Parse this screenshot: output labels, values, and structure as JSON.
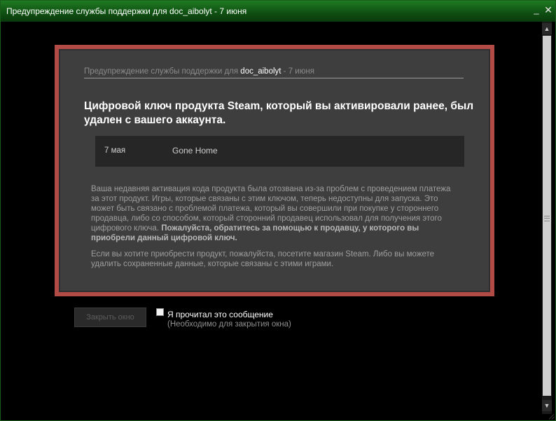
{
  "window": {
    "title": "Предупреждение службы поддержки для doc_aibolyt - 7 июня",
    "minimize_glyph": "_",
    "close_glyph": "✕"
  },
  "notice": {
    "header_prefix": "Предупреждение службы поддержки для ",
    "header_user": "doc_aibolyt",
    "header_suffix": " - 7 июня",
    "headline": "Цифровой ключ продукта Steam, который вы активировали ранее, был удален с вашего аккаунта.",
    "item": {
      "date": "7 мая",
      "game": "Gone Home"
    },
    "paragraph1": "Ваша недавняя активация кода продукта была отозвана из-за проблем с проведением платежа за этот продукт. Игры, которые связаны с этим ключом, теперь недоступны для запуска. Это может быть связано с проблемой платежа, который вы совершили при покупке у стороннего продавца, либо со способом, который сторонний продавец использовал для получения этого цифрового ключа. ",
    "paragraph1_bold": "Пожалуйста, обратитесь за помощью к продавцу, у которого вы приобрели данный цифровой ключ.",
    "paragraph2": "Если вы хотите приобрести продукт, пожалуйста, посетите магазин Steam. Либо вы можете удалить сохраненные данные, которые связаны с этими играми."
  },
  "footer": {
    "close_button": "Закрыть окно",
    "checkbox_label": "Я прочитал это сообщение",
    "checkbox_hint": "(Необходимо для закрытия окна)",
    "checkbox_checked": false
  },
  "scrollbar": {
    "up_glyph": "▲",
    "down_glyph": "▼"
  },
  "colors": {
    "titlebar_green": "#1f7a22",
    "panel_border_red": "#b24a45",
    "panel_bg": "#3e3e3e"
  }
}
